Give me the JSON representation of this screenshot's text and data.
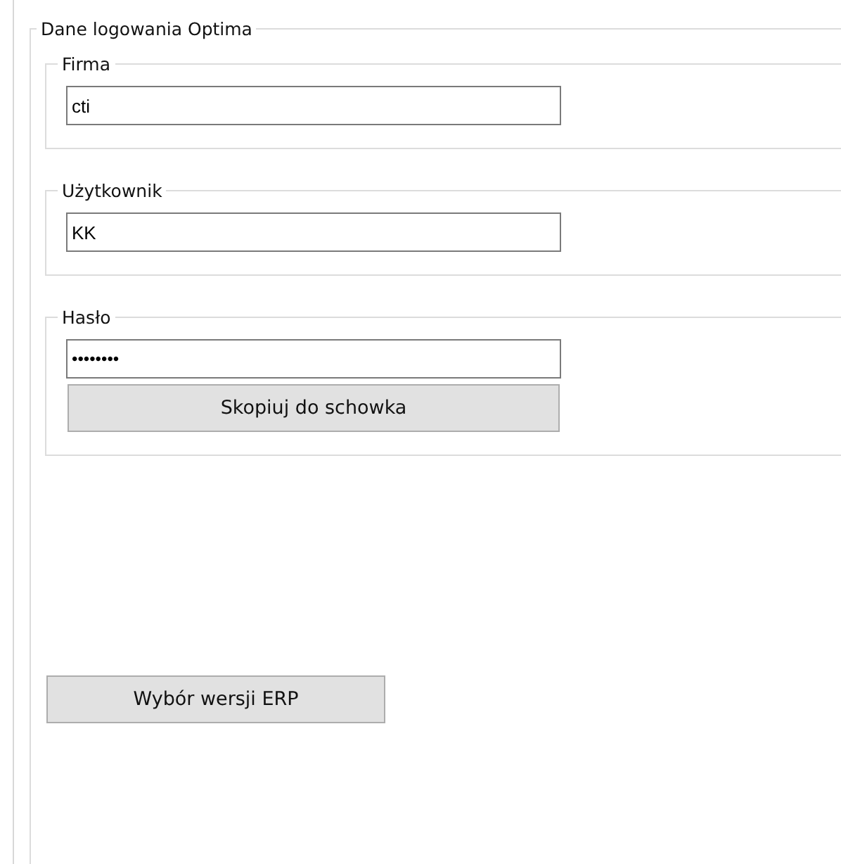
{
  "group": {
    "title": "Dane logowania Optima",
    "fields": [
      {
        "label": "Firma",
        "value": "cti",
        "kind": "text"
      },
      {
        "label": "Użytkownik",
        "value": "KK",
        "kind": "text"
      },
      {
        "label": "Hasło",
        "value": "••••••••",
        "kind": "password",
        "button": "Skopiuj do schowka"
      }
    ]
  },
  "buttons": [
    "Wybór wersji ERP"
  ]
}
